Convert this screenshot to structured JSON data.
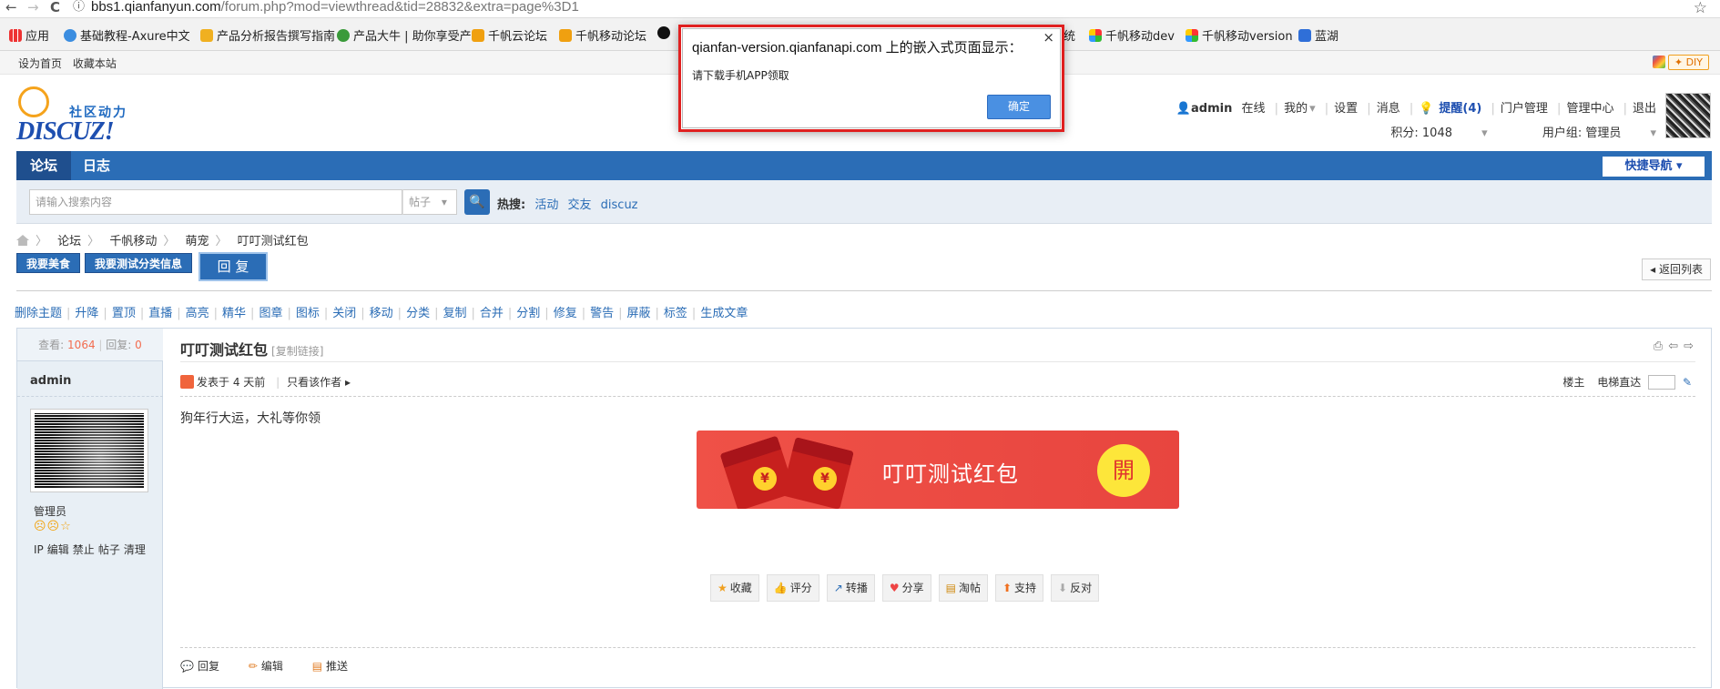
{
  "browser": {
    "back": "←",
    "forward": "→",
    "reload": "C",
    "info": "ⓘ",
    "url_host": "bbs1.qianfanyun.com",
    "url_path": "/forum.php?mod=viewthread&tid=28832&extra=page%3D1",
    "star": "☆",
    "bookmarks": [
      "应用",
      "基础教程-Axure中文",
      "产品分析报告撰写指南",
      "产品大牛 | 助你享受产",
      "千帆云论坛",
      "千帆移动论坛",
      "统",
      "千帆移动dev",
      "千帆移动version",
      "蓝湖"
    ]
  },
  "topbar": {
    "set_home": "设为首页",
    "bookmark": "收藏本站",
    "diy": "DIY"
  },
  "logo": {
    "zh": "社区动力",
    "en": "DISCUZ!"
  },
  "user": {
    "name": "admin",
    "status": "在线",
    "mine": "我的",
    "settings": "设置",
    "messages": "消息",
    "remind": "提醒(4)",
    "portal": "门户管理",
    "admin_center": "管理中心",
    "logout": "退出",
    "points": "积分: 1048",
    "group": "用户组: 管理员"
  },
  "nav": {
    "forum": "论坛",
    "blog": "日志",
    "quick": "快捷导航"
  },
  "search": {
    "placeholder": "请输入搜索内容",
    "type": "帖子",
    "hot_label": "热搜:",
    "hot": [
      "活动",
      "交友",
      "discuz"
    ]
  },
  "breadcrumb": [
    "论坛",
    "千帆移动",
    "萌宠",
    "叮叮测试红包"
  ],
  "post_buttons": {
    "food": "我要美食",
    "test_cat": "我要测试分类信息",
    "reply": "回 复",
    "back": "返回列表"
  },
  "mod_tools": [
    "删除主题",
    "升降",
    "置顶",
    "直播",
    "高亮",
    "精华",
    "图章",
    "图标",
    "关闭",
    "移动",
    "分类",
    "复制",
    "合并",
    "分割",
    "修复",
    "警告",
    "屏蔽",
    "标签",
    "生成文章"
  ],
  "thread": {
    "views_label": "查看:",
    "views": "1064",
    "replies_label": "回复:",
    "replies": "0",
    "title": "叮叮测试红包",
    "copy_link": "[复制链接]",
    "author": "admin",
    "posted": "发表于 4 天前",
    "only_author": "只看该作者",
    "floor": "楼主",
    "jump": "电梯直达",
    "message": "狗年行大运，大礼等你领",
    "redpack_title": "叮叮测试红包",
    "redpack_open": "開",
    "group": "管理员",
    "stars": "☹☹☆",
    "user_actions": [
      "IP",
      "编辑",
      "禁止",
      "帖子",
      "清理"
    ],
    "actions": [
      {
        "icon": "★",
        "label": "收藏"
      },
      {
        "icon": "👍",
        "label": "评分"
      },
      {
        "icon": "↗",
        "label": "转播"
      },
      {
        "icon": "♥",
        "label": "分享"
      },
      {
        "icon": "▤",
        "label": "淘帖"
      },
      {
        "icon": "⬆",
        "label": "支持"
      },
      {
        "icon": "⬇",
        "label": "反对"
      }
    ],
    "foot": [
      "回复",
      "编辑",
      "推送"
    ]
  },
  "dialog": {
    "title": "qianfan-version.qianfanapi.com 上的嵌入式页面显示：",
    "message": "请下载手机APP领取",
    "ok": "确定",
    "close": "×"
  }
}
